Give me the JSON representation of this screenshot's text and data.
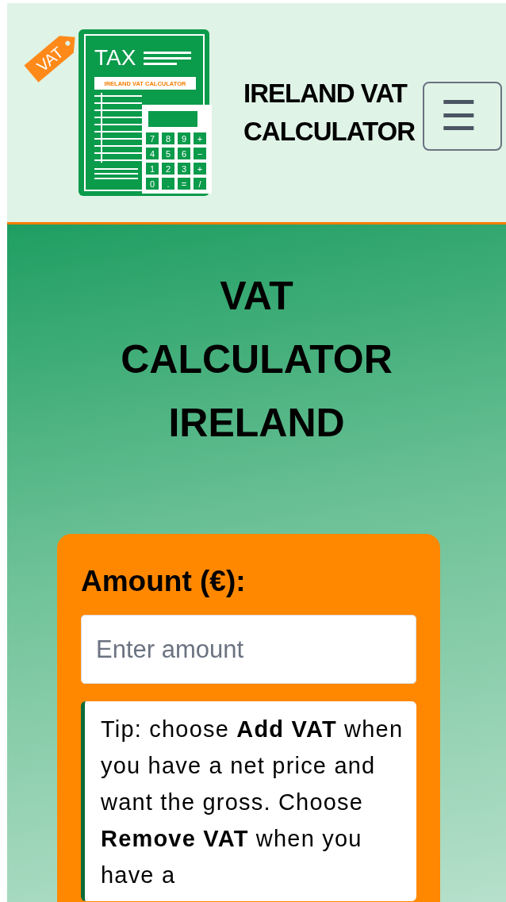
{
  "header": {
    "logo": {
      "tag": "VAT",
      "heading": "TAX",
      "banner": "IRELAND VAT CALCULATOR",
      "keys": [
        "7",
        "8",
        "9",
        "+",
        "4",
        "5",
        "6",
        "−",
        "1",
        "2",
        "3",
        "+",
        "0",
        ".",
        "=",
        "/"
      ]
    },
    "site_title": "IRELAND VAT CALCULATOR",
    "menu_button": "☰"
  },
  "hero": {
    "title": "VAT CALCULATOR IRELAND"
  },
  "calculator": {
    "amount_label": "Amount (€):",
    "amount_field": {
      "placeholder": "Enter amount"
    },
    "tip": "Tip: choose **Add VAT** when you have a net price and want the gross. Choose **Remove VAT** when you have a"
  }
}
